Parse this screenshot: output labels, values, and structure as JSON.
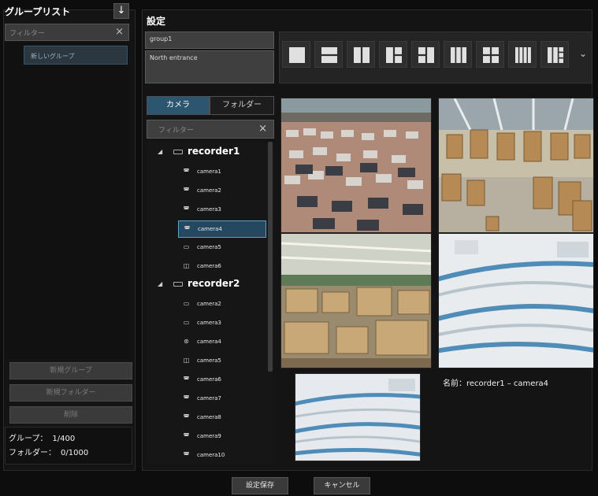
{
  "left_panel": {
    "title": "グループリスト",
    "filter_placeholder": "フィルター",
    "groups": [
      "新しいグループ"
    ],
    "buttons": {
      "new_group": "新規グループ",
      "new_folder": "新規フォルダー",
      "delete": "削除"
    },
    "counts": {
      "group_label": "グループ：",
      "group_value": "1/400",
      "folder_label": "フォルダー：",
      "folder_value": "0/1000"
    }
  },
  "settings": {
    "title": "設定",
    "name_value": "group1",
    "description_value": "North entrance",
    "layout_options": [
      "1",
      "2x1",
      "1x2",
      "1+2",
      "2+1",
      "1x3",
      "2x2",
      "1x4",
      "3+4"
    ]
  },
  "tabs": {
    "camera": "カメラ",
    "folder": "フォルダー"
  },
  "tree_filter_placeholder": "フィルター",
  "tree": [
    {
      "recorder": "recorder1",
      "cameras": [
        {
          "name": "camera1",
          "icon": "dome-icon"
        },
        {
          "name": "camera2",
          "icon": "dome-icon"
        },
        {
          "name": "camera3",
          "icon": "dome-icon"
        },
        {
          "name": "camera4",
          "icon": "dome-icon",
          "selected": true
        },
        {
          "name": "camera5",
          "icon": "box-camera-icon"
        },
        {
          "name": "camera6",
          "icon": "ptz-icon"
        }
      ]
    },
    {
      "recorder": "recorder2",
      "cameras": [
        {
          "name": "camera2",
          "icon": "box-camera-icon"
        },
        {
          "name": "camera3",
          "icon": "box-camera-icon"
        },
        {
          "name": "camera4",
          "icon": "fisheye-icon"
        },
        {
          "name": "camera5",
          "icon": "ptz-icon"
        },
        {
          "name": "camera6",
          "icon": "dome-icon"
        },
        {
          "name": "camera7",
          "icon": "dome-icon"
        },
        {
          "name": "camera8",
          "icon": "dome-icon"
        },
        {
          "name": "camera9",
          "icon": "dome-icon"
        },
        {
          "name": "camera10",
          "icon": "dome-icon"
        }
      ]
    }
  ],
  "preview_label": "名前：recorder1 – camera4",
  "footer": {
    "save": "設定保存",
    "cancel": "キャンセル"
  }
}
